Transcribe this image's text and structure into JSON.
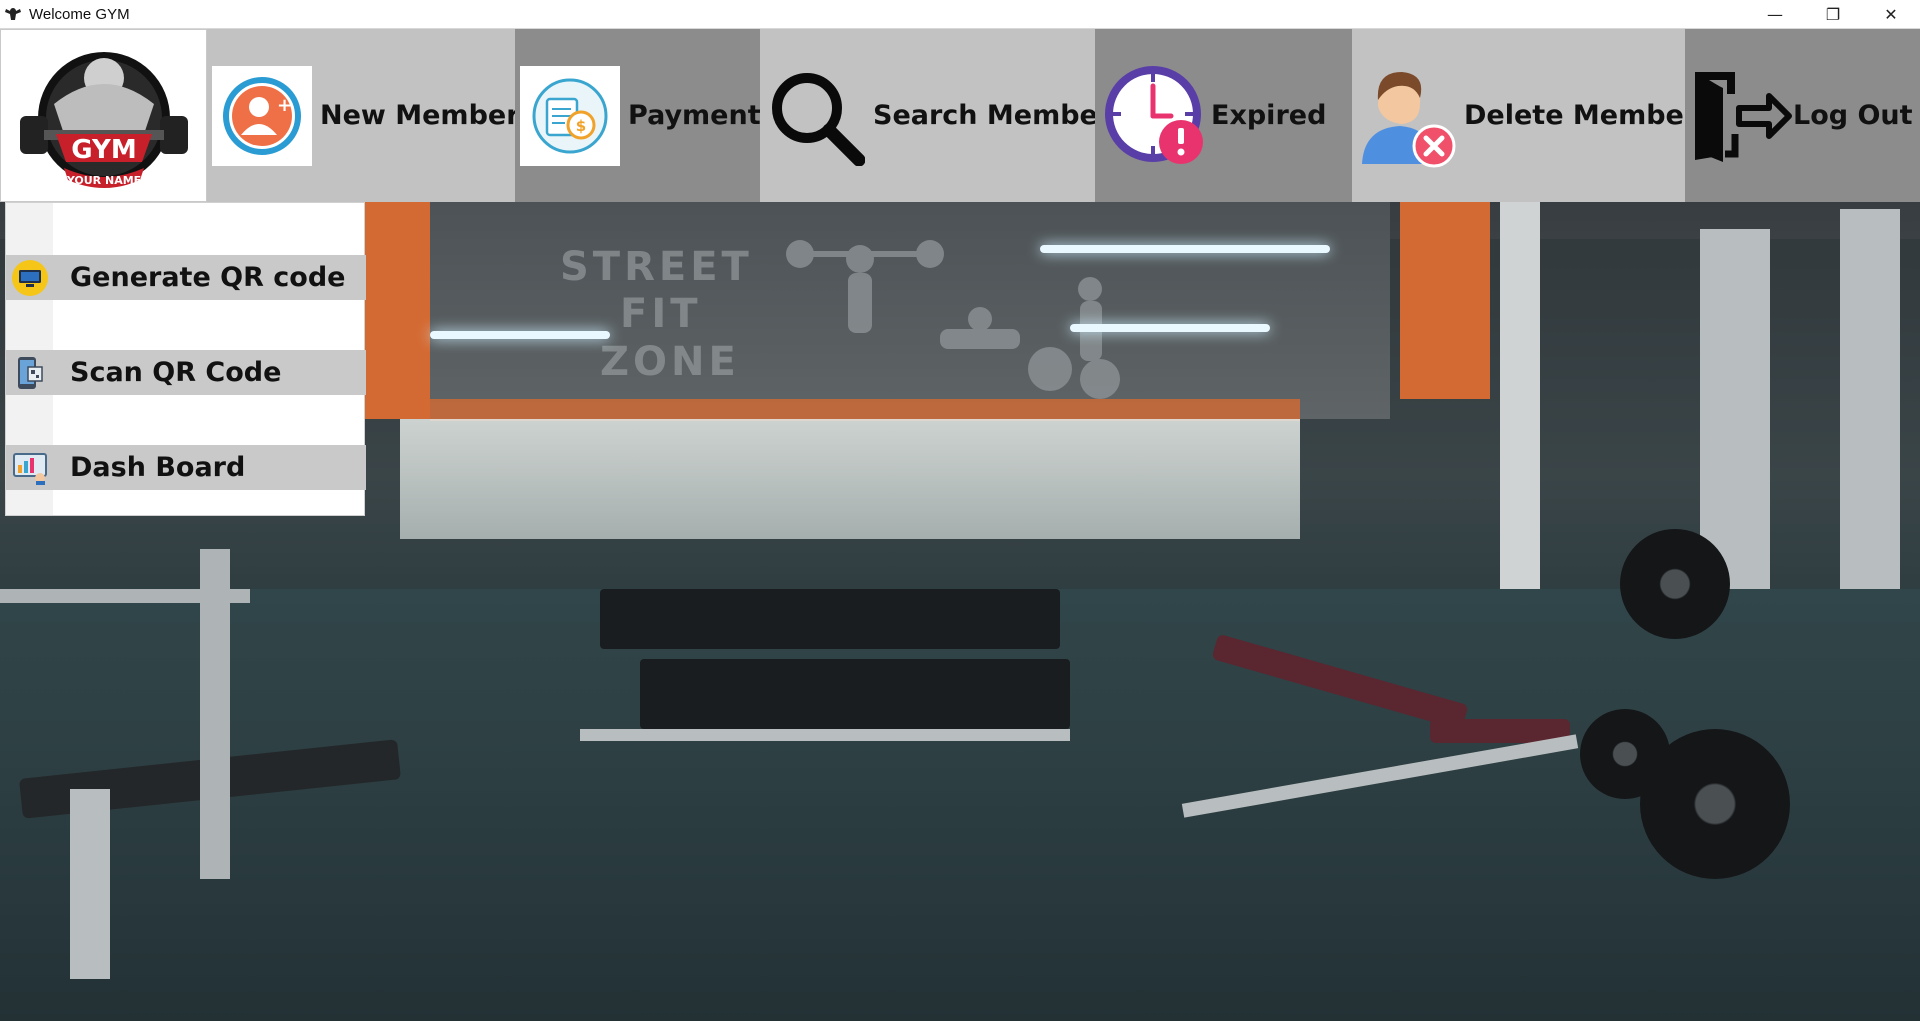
{
  "window": {
    "title": "Welcome GYM",
    "controls": {
      "minimize": "—",
      "restore": "❐",
      "close": "✕"
    }
  },
  "logo": {
    "icon": "gym-logo-icon",
    "top_text": "GYM",
    "bottom_text": "YOUR NAME"
  },
  "toolbar": {
    "new_member": {
      "label": "New Member",
      "icon": "add-user-icon"
    },
    "payment": {
      "label": "Payment",
      "icon": "payment-icon"
    },
    "search_member": {
      "label": "Search Member",
      "icon": "search-icon"
    },
    "expired": {
      "label": "Expired",
      "icon": "clock-alert-icon"
    },
    "delete_member": {
      "label": "Delete Member",
      "icon": "remove-user-icon"
    },
    "log_out": {
      "label": "Log Out",
      "icon": "logout-icon"
    }
  },
  "menu": {
    "items": [
      {
        "label": "Generate QR code",
        "icon": "monitor-icon"
      },
      {
        "label": "Scan QR Code",
        "icon": "phone-scan-icon"
      },
      {
        "label": "Dash Board",
        "icon": "dashboard-icon"
      }
    ]
  },
  "background": {
    "wall_art_text": [
      "STREET",
      "FIT",
      "ZONE"
    ]
  },
  "colors": {
    "toolbar_light": "#c2c2c2",
    "toolbar_dark": "#8c8c8c",
    "menu_item_bg": "#c9c9c9",
    "logo_red": "#c8202a",
    "expired_purple": "#5a3ea8",
    "expired_pink": "#e8336f",
    "delete_red": "#f0506a"
  }
}
